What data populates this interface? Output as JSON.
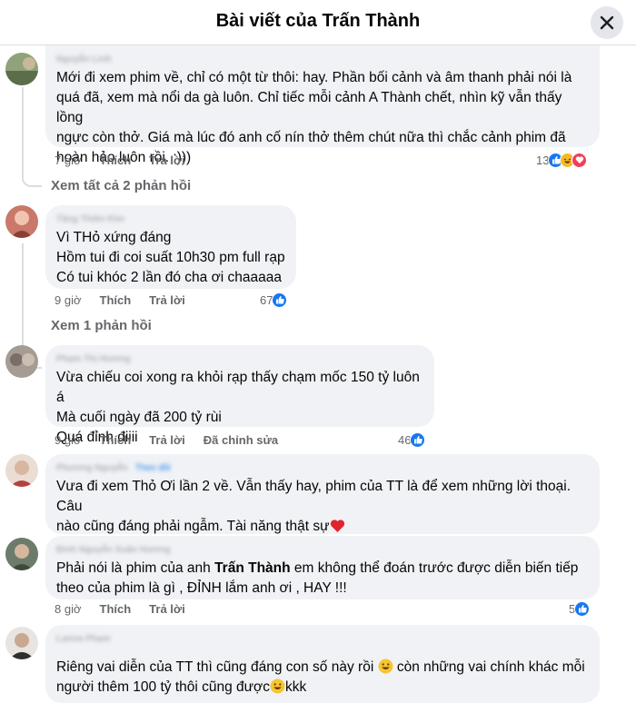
{
  "header": {
    "title": "Bài viết của Trấn Thành"
  },
  "comments": [
    {
      "author": "Nguyễn Linh",
      "lines": [
        "Mới đi xem phim về, chỉ có một từ thôi: hay. Phần bối cảnh và âm thanh phải nói là",
        "quá đã, xem mà nổi da gà luôn. Chỉ tiếc mỗi cảnh A Thành chết, nhìn kỹ vẫn thấy lồng",
        "ngực còn thở. Giá mà lúc đó anh cố nín thở thêm chút nữa thì chắc cảnh phim đã",
        "hoàn hảo luôn rồi. :)))"
      ],
      "time": "7 giờ",
      "like": "Thích",
      "reply": "Trả lời",
      "reaction_count": "13",
      "view_replies": "Xem tất cả 2 phản hồi"
    },
    {
      "author": "Tăng Thiên Kim",
      "lines": [
        "Vì THỏ xứng đáng",
        "Hồm tui đi coi suất 10h30 pm full rạp",
        "Có tui khóc 2 lần đó cha ơi chaaaaa"
      ],
      "time": "9 giờ",
      "like": "Thích",
      "reply": "Trả lời",
      "reaction_count": "67",
      "view_replies": "Xem 1 phản hồi"
    },
    {
      "author": "Phạm Thị Hương",
      "lines": [
        "Vừa chiếu coi xong ra khỏi rạp thấy chạm mốc 150 tỷ luôn á",
        "Mà cuối ngày đã 200 tỷ rùi",
        "Quá đỉnh điiii"
      ],
      "time": "9 giờ",
      "like": "Thích",
      "reply": "Trả lời",
      "edited": "Đã chỉnh sửa",
      "reaction_count": "46"
    },
    {
      "author": "Phương Nguyễn",
      "badge": "Theo dõi",
      "lines": [
        "Vưa đi xem Thỏ Ơi lần 2 về. Vẫn thấy hay, phim của TT là để xem những lời thoại. Câu",
        "nào cũng đáng phải ngẫm. Tài năng thật sự"
      ]
    },
    {
      "author": "Đinh Nguyễn Xuân Hương",
      "line1_before": "Phải nói là phim của anh ",
      "line1_bold": "Trấn Thành",
      "line1_after": " em không thể đoán trước được diễn biến tiếp",
      "line2": "theo của phim là gì , ĐỈNH lắm anh ơi , HAY !!!",
      "time": "8 giờ",
      "like": "Thích",
      "reply": "Trả lời",
      "reaction_count": "5"
    },
    {
      "author": "Lanna Phạm",
      "line1_before": "Riêng vai diễn của TT thì cũng đáng con số này rồi ",
      "line1_after": " còn những vai chính khác mỗi",
      "line2_before": "người thêm 100 tỷ thôi cũng được",
      "line2_after": "kkk"
    }
  ]
}
